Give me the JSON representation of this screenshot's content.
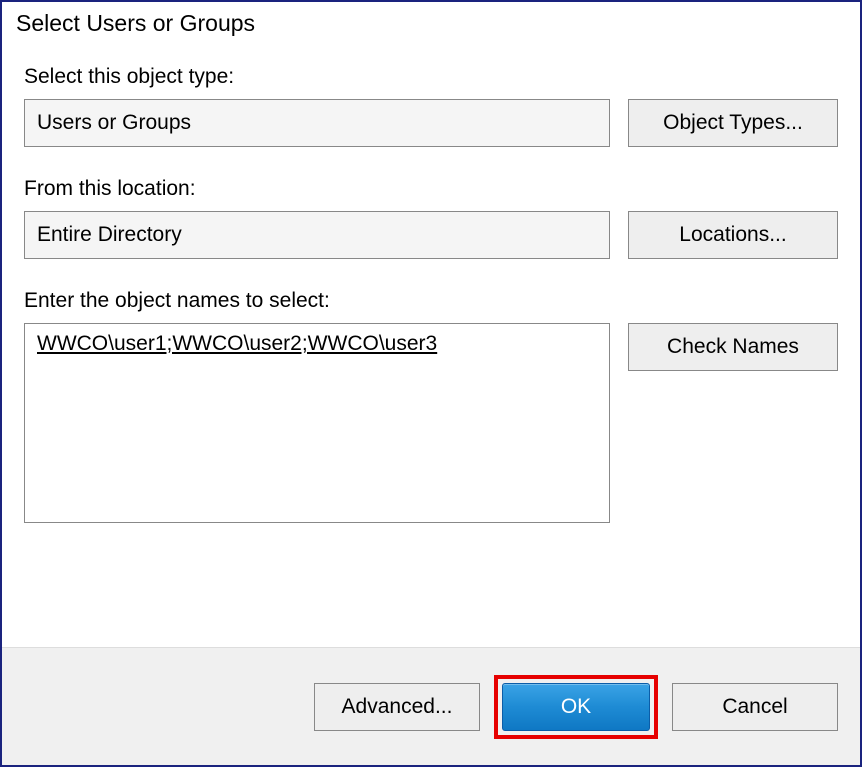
{
  "title": "Select Users or Groups",
  "objectType": {
    "label": "Select this object type:",
    "value": "Users or Groups",
    "button": "Object Types..."
  },
  "location": {
    "label": "From this location:",
    "value": "Entire Directory",
    "button": "Locations..."
  },
  "objectNames": {
    "label": "Enter the object names to select:",
    "value": "WWCO\\user1;WWCO\\user2;WWCO\\user3",
    "button": "Check Names"
  },
  "footer": {
    "advanced": "Advanced...",
    "ok": "OK",
    "cancel": "Cancel"
  }
}
